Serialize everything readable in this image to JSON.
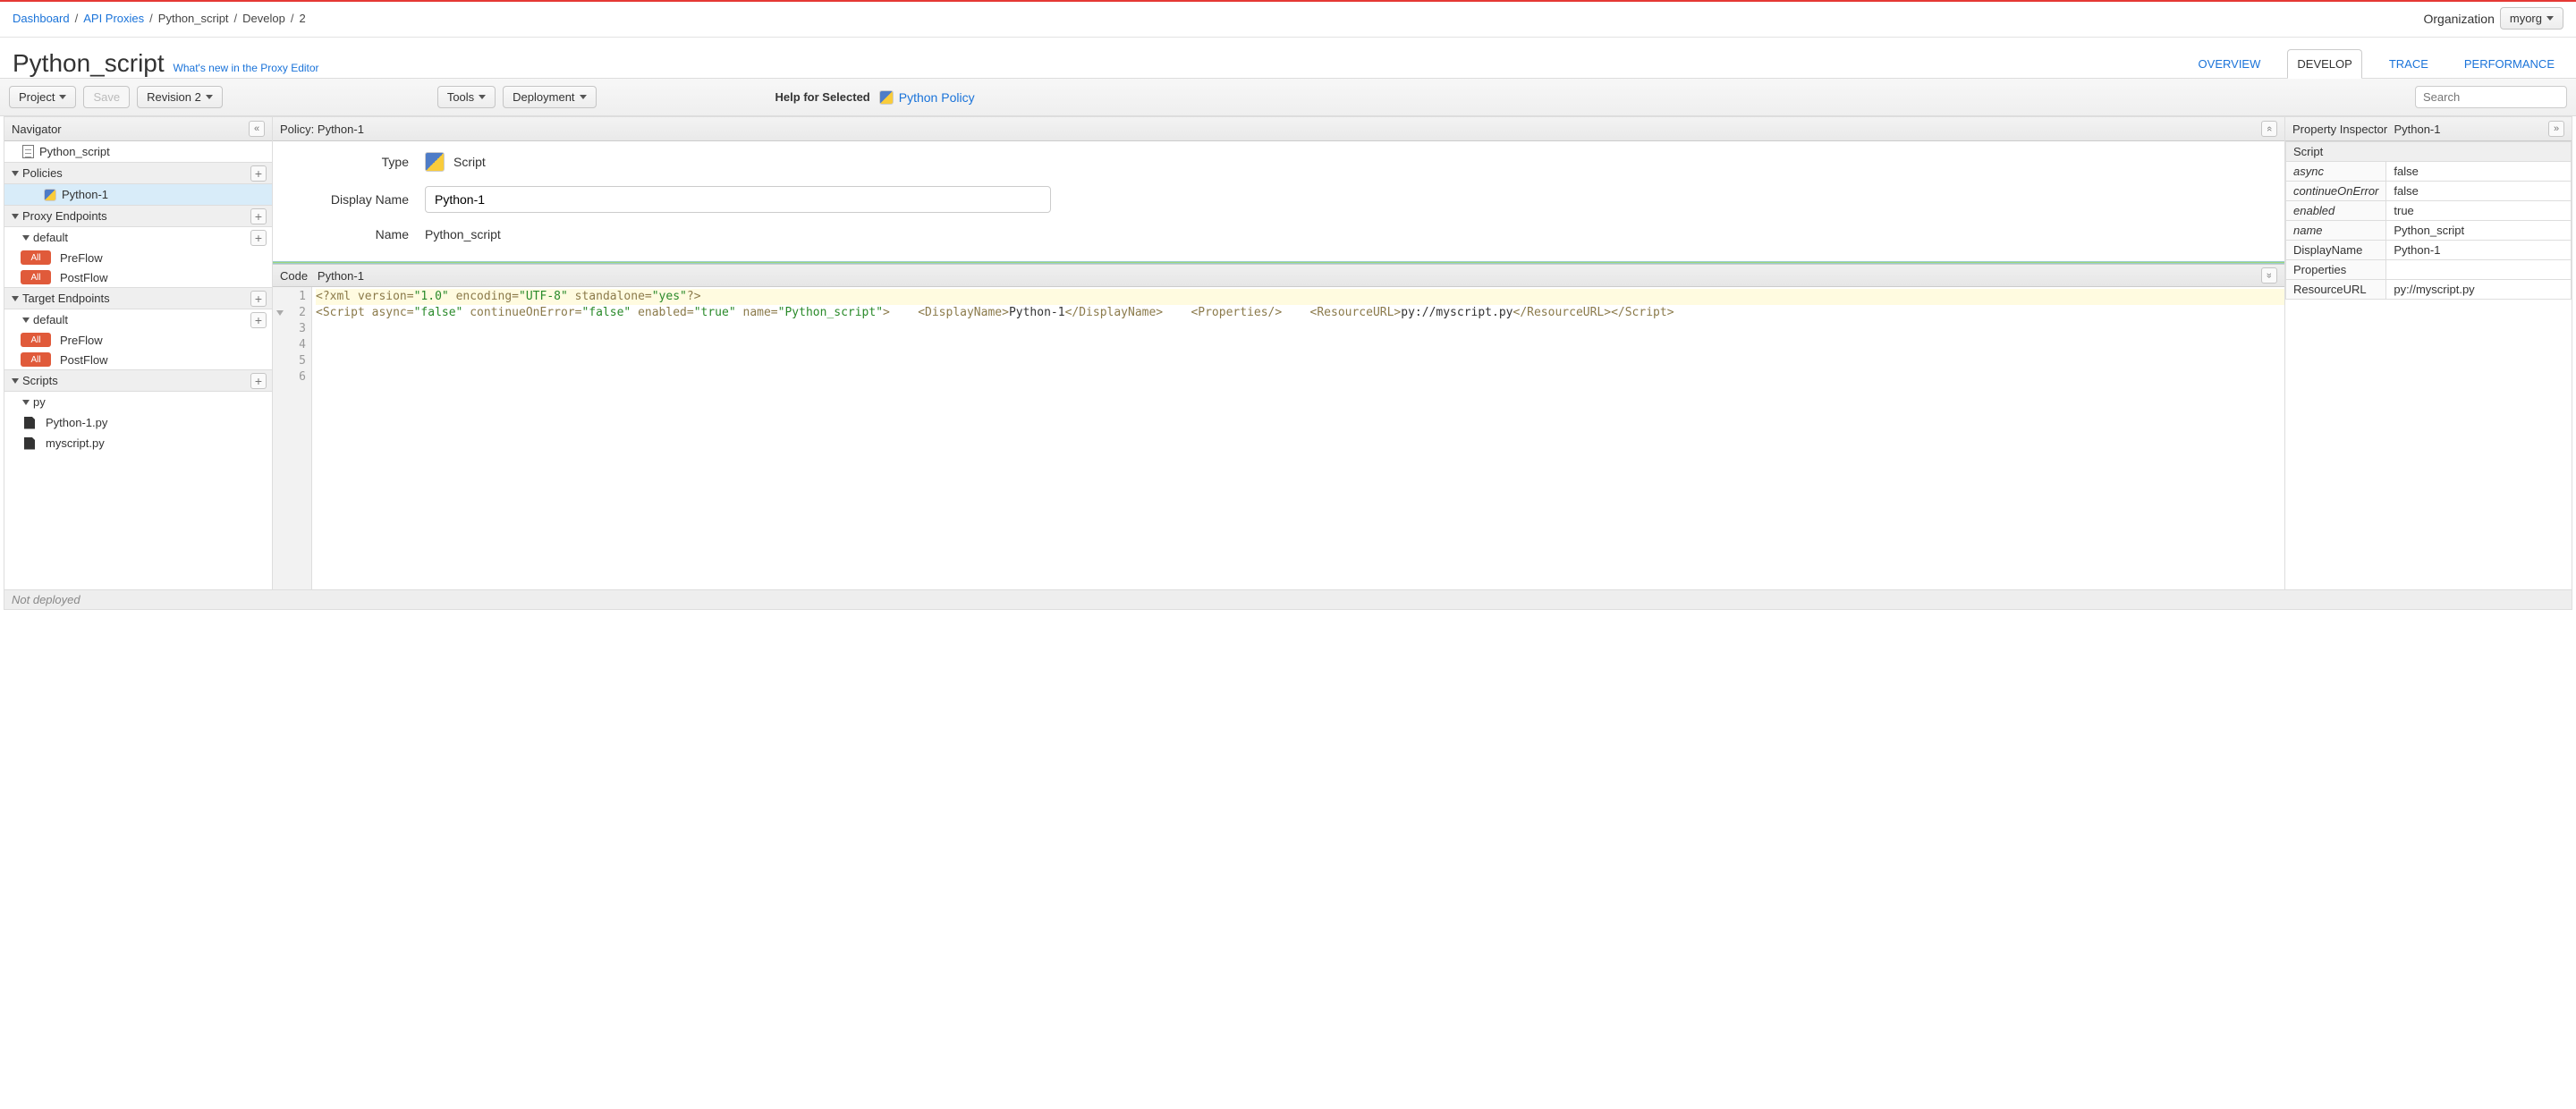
{
  "breadcrumb": {
    "items": [
      "Dashboard",
      "API Proxies",
      "Python_script",
      "Develop",
      "2"
    ],
    "linked": [
      true,
      true,
      false,
      false,
      false
    ]
  },
  "org": {
    "label": "Organization",
    "value": "myorg"
  },
  "title": "Python_script",
  "whats_new": "What's new in the Proxy Editor",
  "tabs": [
    "OVERVIEW",
    "DEVELOP",
    "TRACE",
    "PERFORMANCE"
  ],
  "active_tab": 1,
  "toolbar": {
    "project": "Project",
    "save": "Save",
    "revision": "Revision 2",
    "tools": "Tools",
    "deployment": "Deployment",
    "help_label": "Help for Selected",
    "help_link": "Python Policy",
    "search_placeholder": "Search"
  },
  "navigator": {
    "title": "Navigator",
    "root": "Python_script",
    "policies_label": "Policies",
    "policies": [
      {
        "name": "Python-1",
        "selected": true
      }
    ],
    "proxy_ep_label": "Proxy Endpoints",
    "proxy_ep": [
      {
        "name": "default",
        "flows": [
          "PreFlow",
          "PostFlow"
        ]
      }
    ],
    "target_ep_label": "Target Endpoints",
    "target_ep": [
      {
        "name": "default",
        "flows": [
          "PreFlow",
          "PostFlow"
        ]
      }
    ],
    "scripts_label": "Scripts",
    "scripts_group": "py",
    "scripts": [
      "Python-1.py",
      "myscript.py"
    ],
    "flow_badge": "All"
  },
  "policy_header": "Policy: Python-1",
  "form": {
    "type_label": "Type",
    "type_value": "Script",
    "display_label": "Display Name",
    "display_value": "Python-1",
    "name_label": "Name",
    "name_value": "Python_script"
  },
  "code": {
    "header_left": "Code",
    "header_right": "Python-1",
    "lines": [
      {
        "html": "<span class='tag'>&lt;?xml</span> <span class='attr'>version=</span><span class='str'>\"1.0\"</span> <span class='attr'>encoding=</span><span class='str'>\"UTF-8\"</span> <span class='attr'>standalone=</span><span class='str'>\"yes\"</span><span class='tag'>?&gt;</span>",
        "hl": true
      },
      {
        "html": "<span class='tag'>&lt;Script</span> <span class='attr'>async=</span><span class='str'>\"false\"</span> <span class='attr'>continueOnError=</span><span class='str'>\"false\"</span> <span class='attr'>enabled=</span><span class='str'>\"true\"</span> <span class='attr'>name=</span><span class='str'>\"Python_script\"</span><span class='tag'>&gt;</span>",
        "fold": true
      },
      {
        "html": "    <span class='tag'>&lt;DisplayName&gt;</span><span class='txt'>Python-1</span><span class='tag'>&lt;/DisplayName&gt;</span>"
      },
      {
        "html": "    <span class='tag'>&lt;Properties/&gt;</span>"
      },
      {
        "html": "    <span class='tag'>&lt;ResourceURL&gt;</span><span class='txt'>py://myscript.py</span><span class='tag'>&lt;/ResourceURL&gt;</span>"
      },
      {
        "html": "<span class='tag'>&lt;/Script&gt;</span>"
      }
    ]
  },
  "inspector": {
    "title_prefix": "Property Inspector",
    "title_entity": "Python-1",
    "section": "Script",
    "rows": [
      {
        "k": "async",
        "v": "false",
        "italic": true
      },
      {
        "k": "continueOnError",
        "v": "false",
        "italic": true
      },
      {
        "k": "enabled",
        "v": "true",
        "italic": true
      },
      {
        "k": "name",
        "v": "Python_script",
        "italic": true
      },
      {
        "k": "DisplayName",
        "v": "Python-1"
      },
      {
        "k": "Properties",
        "v": ""
      },
      {
        "k": "ResourceURL",
        "v": "py://myscript.py"
      }
    ]
  },
  "status": "Not deployed"
}
